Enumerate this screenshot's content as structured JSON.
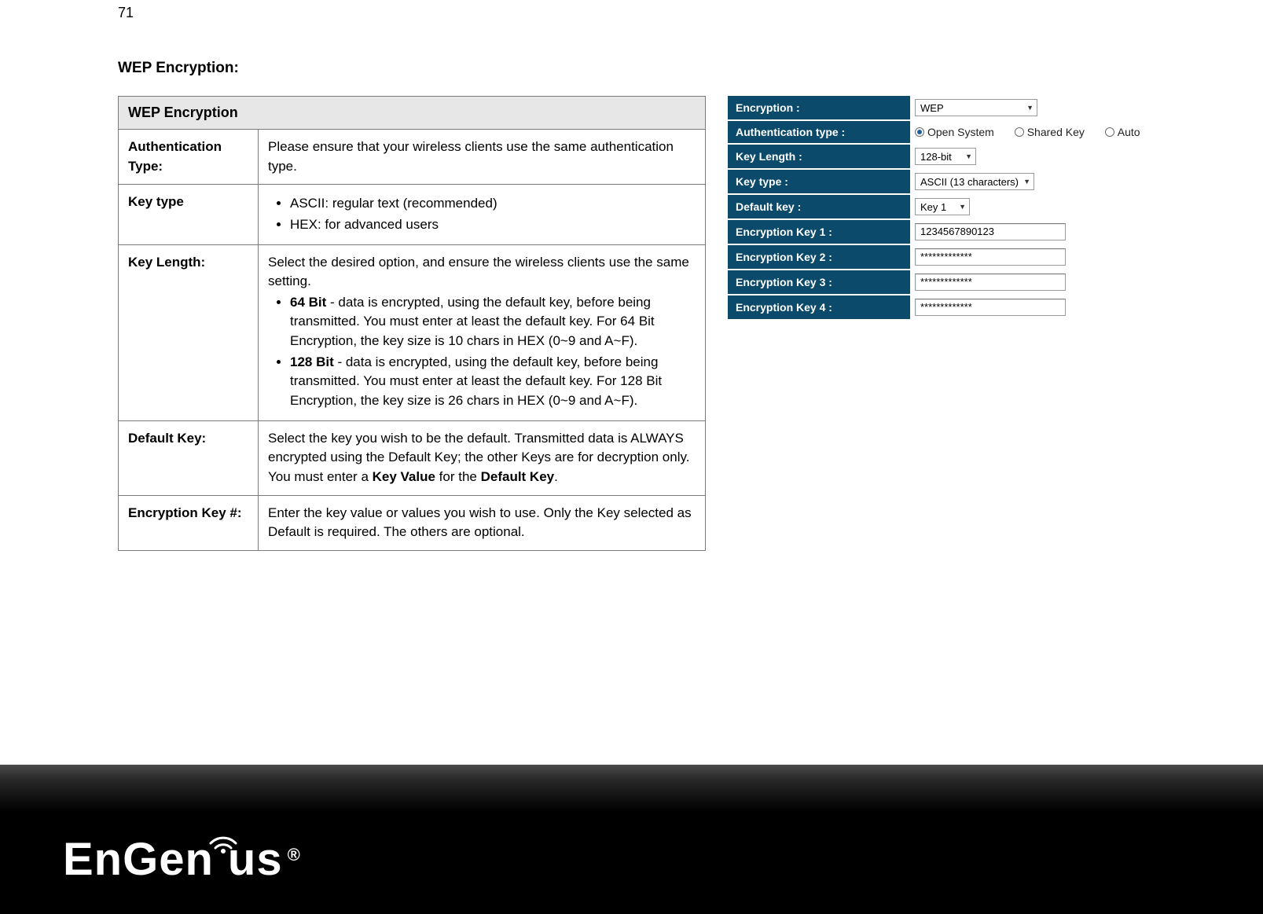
{
  "page": {
    "number": "71",
    "heading": "WEP Encryption:"
  },
  "ref_table": {
    "header": "WEP Encryption",
    "rows": {
      "auth_type": {
        "label": "Authentication Type:",
        "text": "Please ensure that your wireless clients use the same authentication type."
      },
      "key_type": {
        "label": "Key type",
        "bullets": [
          "ASCII: regular text (recommended)",
          "HEX: for advanced users"
        ]
      },
      "key_length": {
        "label": "Key Length:",
        "intro": "Select the desired option, and ensure the wireless clients use the same setting.",
        "b64_label": "64 Bit",
        "b64_text": " - data is encrypted, using the default key, before being transmitted. You must enter at least the default key. For 64 Bit Encryption, the key size is 10 chars in HEX (0~9 and A~F).",
        "b128_label": "128 Bit",
        "b128_text": " - data is encrypted, using the default key, before being transmitted. You must enter at least the default key. For 128 Bit Encryption, the key size is 26 chars in HEX (0~9 and A~F)."
      },
      "default_key": {
        "label": "Default Key:",
        "t1": "Select the key you wish to be the default. Transmitted data is ALWAYS encrypted using the Default Key; the other Keys are for decryption only. You must enter a ",
        "b1": "Key Value",
        "t2": " for the ",
        "b2": "Default Key",
        "t3": "."
      },
      "enc_key": {
        "label": "Encryption Key #:",
        "text": "Enter the key value or values you wish to use. Only the Key selected as Default is required. The others are optional."
      }
    }
  },
  "form": {
    "encryption": {
      "label": "Encryption :",
      "value": "WEP"
    },
    "auth_type": {
      "label": "Authentication type :",
      "options": {
        "open": "Open System",
        "shared": "Shared Key",
        "auto": "Auto"
      }
    },
    "key_length": {
      "label": "Key Length :",
      "value": "128-bit"
    },
    "key_type": {
      "label": "Key type :",
      "value": "ASCII (13 characters)"
    },
    "default_key": {
      "label": "Default key :",
      "value": "Key 1"
    },
    "enc_key_1": {
      "label": "Encryption Key 1 :",
      "value": "1234567890123"
    },
    "enc_key_2": {
      "label": "Encryption Key 2 :",
      "value": "*************"
    },
    "enc_key_3": {
      "label": "Encryption Key 3 :",
      "value": "*************"
    },
    "enc_key_4": {
      "label": "Encryption Key 4 :",
      "value": "*************"
    }
  },
  "brand": {
    "name": "EnGenius",
    "part1": "EnGen",
    "part2": "us",
    "reg": "®"
  }
}
